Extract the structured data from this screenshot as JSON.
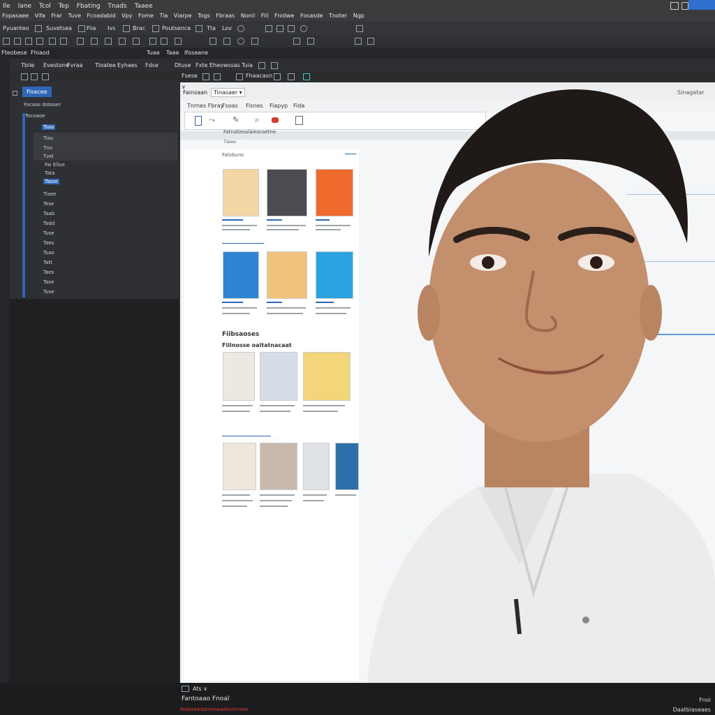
{
  "menubar": {
    "items": [
      "Ile",
      "Iane",
      "Tcol",
      "Tep",
      "Fbating",
      "Tnads",
      "Taaee"
    ],
    "items2": [
      "Fopasaee",
      "Vifa",
      "Frar",
      "Tuve",
      "Fcoadabid",
      "Vpy",
      "Fome",
      "Tia",
      "Viarpe",
      "Togs",
      "Fbraas",
      "Nonil",
      "Fill",
      "Fnidwe",
      "Fosasde",
      "Tnoter",
      "Ngp"
    ]
  },
  "toolbar1": {
    "labels": [
      "Pyuanteo",
      "Suvetsea",
      "Fiia",
      "Ivs",
      "Brac",
      "Poutsence",
      "Tta",
      "Lov"
    ]
  },
  "panelbar": {
    "tabs": [
      "Fteobese",
      "Fhiaod",
      "Tuaa",
      "Taaa",
      "Ifosaane"
    ]
  },
  "toolbar3": {
    "labels": [
      "Tbiie",
      "Evestone",
      "Fvraa",
      "Tloatee",
      "Eyhaes",
      "Fdse",
      "Dtuse",
      "Fxte",
      "Eheowssas",
      "Tuia"
    ]
  },
  "toolbar4": {
    "labels": [
      "Fsese",
      "Fhaacasn"
    ]
  },
  "leftpanel": {
    "selected": "Fisacee",
    "subtitle": "Focase dotoser",
    "items": [
      "Tocoaoe",
      "Tsaa",
      "Tiav",
      "Tno",
      "Tvel",
      "Fai Ellue",
      "Tata",
      "Tasse",
      "Tiase",
      "Tese",
      "Taab",
      "Tadd",
      "Tuse",
      "Taes",
      "Tuas",
      "Tatt",
      "Taes",
      "Tase",
      "Tuse"
    ]
  },
  "document": {
    "title_left": "Fainsaan",
    "title_dropdown": "Tinasaer",
    "title_right": "Sinagatar",
    "tabs": [
      "Tnrnes Fbray",
      "Fsoas",
      "Fisnes",
      "Fiapyp",
      "Fida"
    ],
    "ruler_text": "Fatnatiesslaiearaetne",
    "ruler_sub": "Tialee",
    "section_label": "Fatsbuns",
    "section2": "Fiibsaoses",
    "section3": "Fiilnosse oaitatnacaat"
  },
  "status": {
    "dropdown": "Ats",
    "left_line": "Fantoaao Fnoal",
    "left_sub": "Fepotaedatnenaadentnnsse",
    "right_line": "Fnoi",
    "right_sub": "Daatbiaseaes"
  },
  "colors": {
    "accent": "#2e67b7",
    "status_red": "#e53935"
  }
}
